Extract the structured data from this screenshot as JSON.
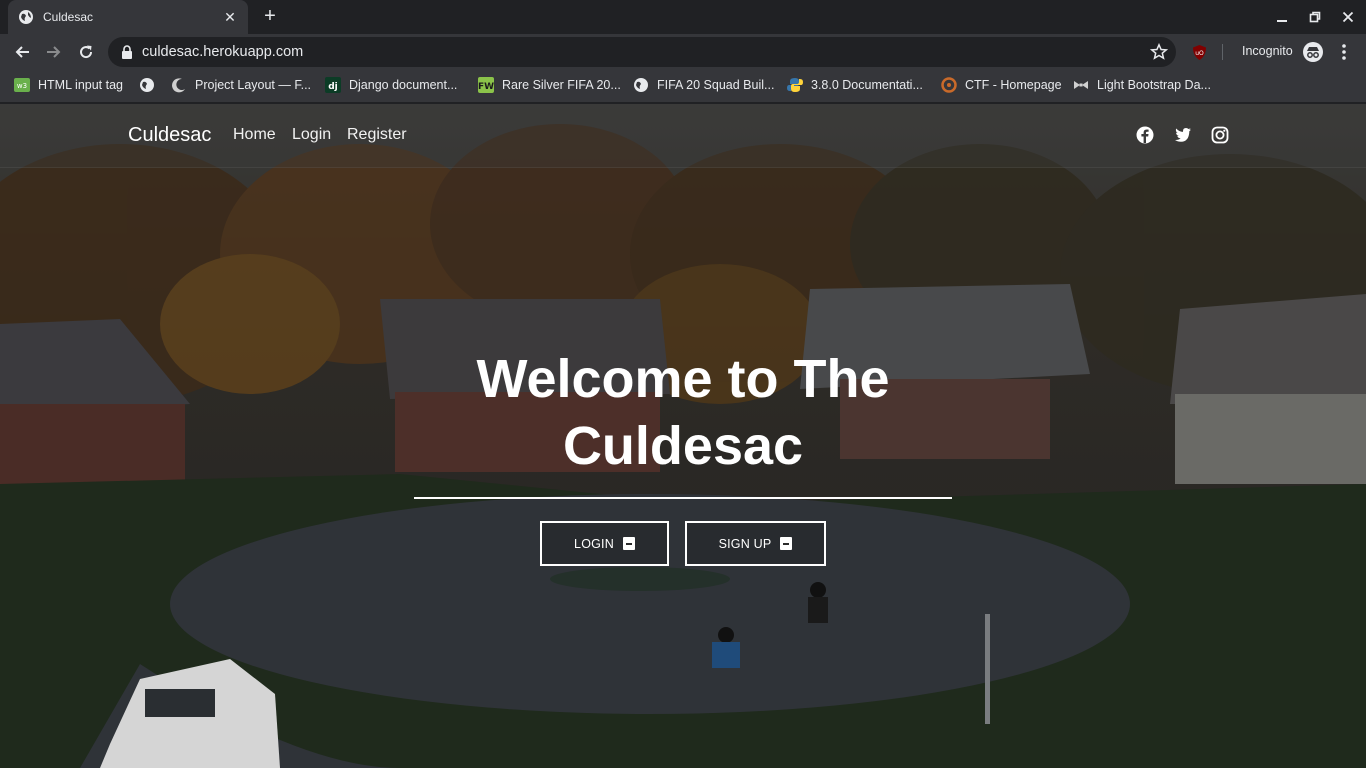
{
  "browser": {
    "tab": {
      "title": "Culdesac",
      "close": "✕"
    },
    "new_tab": "+",
    "url": "culdesac.herokuapp.com",
    "profile_label": "Incognito",
    "bookmarks": [
      {
        "label": "HTML input tag",
        "icon": "w3-icon"
      },
      {
        "label": "",
        "icon": "globe-icon"
      },
      {
        "label": "Project Layout — F...",
        "icon": "moon-icon"
      },
      {
        "label": "Django document...",
        "icon": "django-icon"
      },
      {
        "label": "Rare Silver FIFA 20...",
        "icon": "futwiz-icon"
      },
      {
        "label": "FIFA 20 Squad Buil...",
        "icon": "globe-icon"
      },
      {
        "label": "3.8.0 Documentati...",
        "icon": "python-icon"
      },
      {
        "label": "CTF - Homepage",
        "icon": "ctf-icon"
      },
      {
        "label": "Light Bootstrap Da...",
        "icon": "bowtie-icon"
      }
    ]
  },
  "site": {
    "brand": "Culdesac",
    "nav": [
      "Home",
      "Login",
      "Register"
    ],
    "social": [
      "facebook-icon",
      "twitter-icon",
      "instagram-icon"
    ],
    "hero": {
      "title": "Welcome to The Culdesac",
      "login_label": "LOGIN",
      "signup_label": "SIGN UP"
    }
  },
  "colors": {
    "chrome_dark": "#202124",
    "chrome_toolbar": "#35363a",
    "text_light": "#e8eaed"
  }
}
